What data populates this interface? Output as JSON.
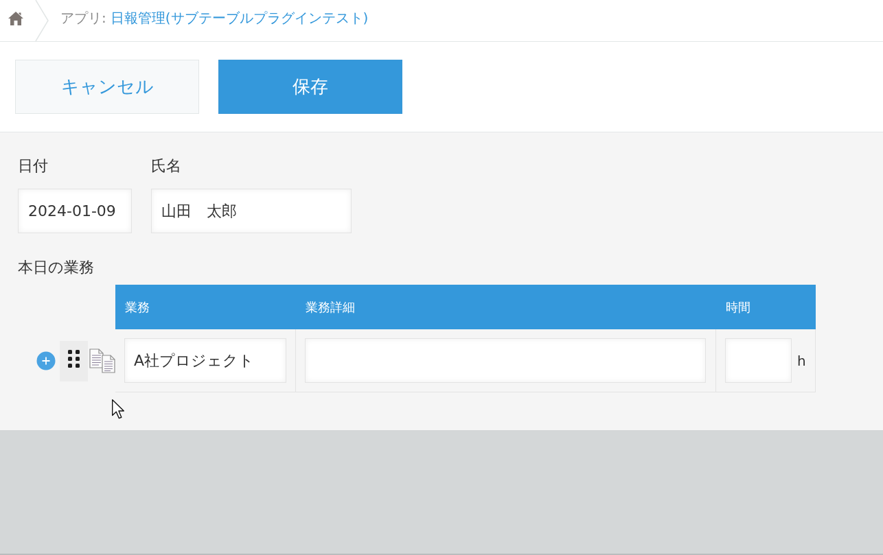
{
  "breadcrumb": {
    "prefix": "アプリ:",
    "app_name": "日報管理(サブテーブルプラグインテスト)"
  },
  "toolbar": {
    "buttons": [
      {
        "label": "キャンセル",
        "kind": "cancel"
      },
      {
        "label": "保存",
        "kind": "save"
      }
    ]
  },
  "fields": [
    {
      "label": "日付",
      "value": "2024-01-09",
      "kind": "date"
    },
    {
      "label": "氏名",
      "value": "山田　太郎",
      "kind": "text"
    }
  ],
  "subtable": {
    "label": "本日の業務",
    "columns": [
      {
        "label": "業務"
      },
      {
        "label": "業務詳細"
      },
      {
        "label": "時間"
      }
    ],
    "rows": [
      {
        "cells": [
          {
            "value": "A社プロジェクト"
          },
          {},
          {
            "unit": "h"
          }
        ]
      }
    ]
  }
}
